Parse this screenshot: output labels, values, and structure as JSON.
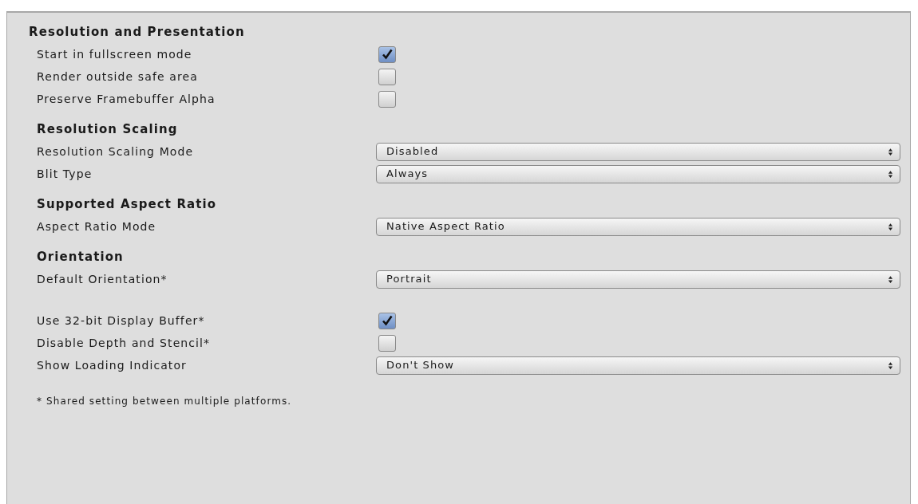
{
  "title": "Resolution and Presentation",
  "rows": [
    {
      "kind": "checkbox",
      "label": "Start in fullscreen mode",
      "checked": true
    },
    {
      "kind": "checkbox",
      "label": "Render outside safe area",
      "checked": false
    },
    {
      "kind": "checkbox",
      "label": "Preserve Framebuffer Alpha",
      "checked": false
    }
  ],
  "sections": [
    {
      "heading": "Resolution Scaling",
      "rows": [
        {
          "kind": "dropdown",
          "label": "Resolution Scaling Mode",
          "value": "Disabled"
        },
        {
          "kind": "dropdown",
          "label": "Blit Type",
          "value": "Always"
        }
      ]
    },
    {
      "heading": "Supported Aspect Ratio",
      "rows": [
        {
          "kind": "dropdown",
          "label": "Aspect Ratio Mode",
          "value": "Native Aspect Ratio"
        }
      ]
    },
    {
      "heading": "Orientation",
      "rows": [
        {
          "kind": "dropdown",
          "label": "Default Orientation*",
          "value": "Portrait"
        }
      ]
    },
    {
      "rows": [
        {
          "kind": "checkbox",
          "label": "Use 32-bit Display Buffer*",
          "checked": true
        },
        {
          "kind": "checkbox",
          "label": "Disable Depth and Stencil*",
          "checked": false
        },
        {
          "kind": "dropdown",
          "label": "Show Loading Indicator",
          "value": "Don't Show"
        }
      ]
    }
  ],
  "footnote": "* Shared setting between multiple platforms."
}
